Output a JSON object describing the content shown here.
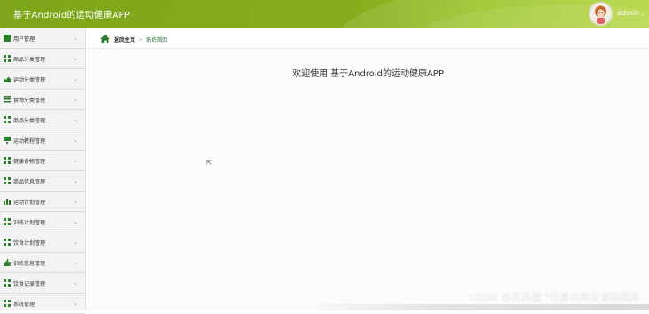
{
  "app": {
    "title": "基于Android的运动健康APP"
  },
  "user": {
    "name": "admin",
    "caret": "⌄"
  },
  "sidebar": {
    "items": [
      {
        "label": "用户管理",
        "icon": "clipboard-icon"
      },
      {
        "label": "商品分类管理",
        "icon": "grid-icon"
      },
      {
        "label": "运动分类管理",
        "icon": "line-chart-icon"
      },
      {
        "label": "食物分类管理",
        "icon": "list-icon"
      },
      {
        "label": "商品分类管理",
        "icon": "grid-icon"
      },
      {
        "label": "运动教程管理",
        "icon": "monitor-icon"
      },
      {
        "label": "健康食物管理",
        "icon": "grid-icon"
      },
      {
        "label": "商品信息管理",
        "icon": "grid-icon"
      },
      {
        "label": "运动计划管理",
        "icon": "bar-chart-icon"
      },
      {
        "label": "训练计划管理",
        "icon": "grid-icon"
      },
      {
        "label": "饮食计划管理",
        "icon": "grid-icon"
      },
      {
        "label": "训练信息管理",
        "icon": "thumbs-up-icon"
      },
      {
        "label": "饮食记录管理",
        "icon": "grid-icon"
      },
      {
        "label": "系统管理",
        "icon": "grid-icon"
      }
    ],
    "chevron": "⌄"
  },
  "breadcrumb": {
    "home": "返回主页",
    "separator": "▷",
    "current": "系统首页"
  },
  "main": {
    "welcome": "欢迎使用 基于Android的运动健康APP"
  },
  "watermark": "CSDN @苏苏酱   °计算机毕设源码程序",
  "colors": {
    "accent": "#86ae1c",
    "icon": "#2f7d2f"
  }
}
